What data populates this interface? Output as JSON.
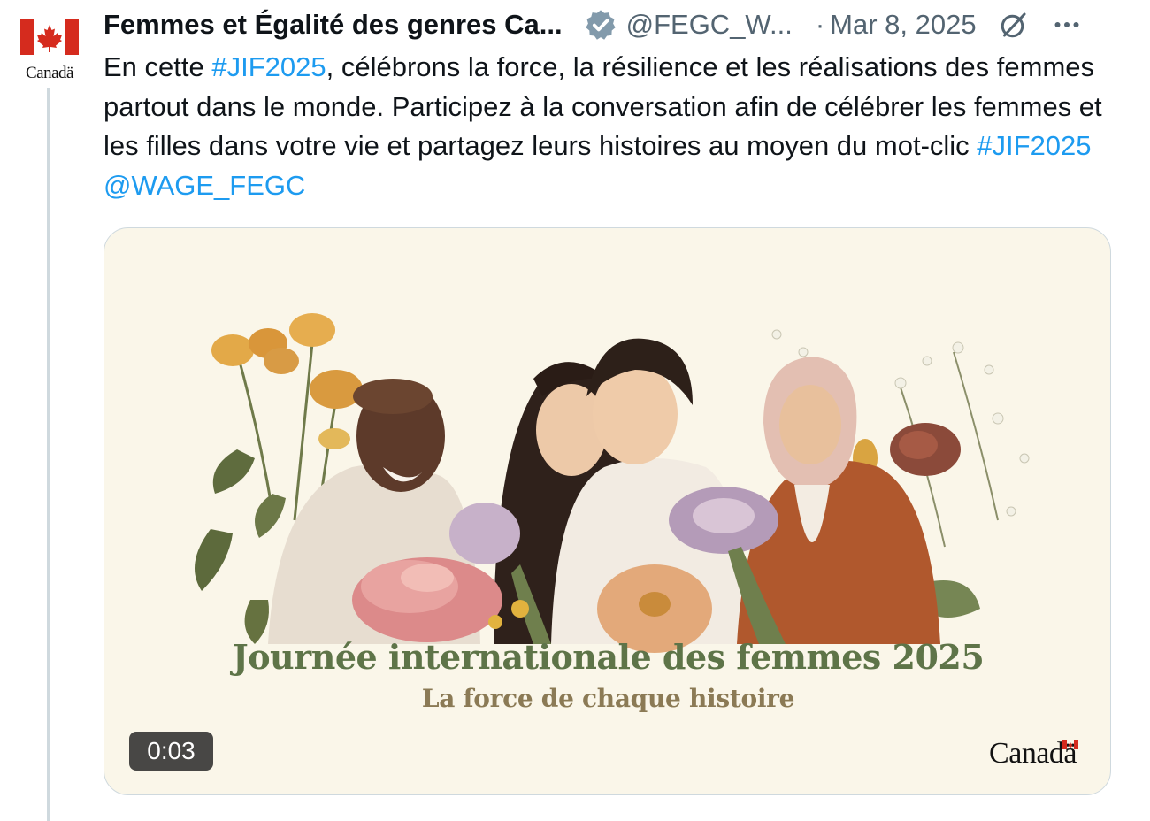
{
  "tweet": {
    "author_name": "Femmes et Égalité des genres Ca...",
    "handle": "@FEGC_W...",
    "separator": "·",
    "date": "Mar 8, 2025",
    "avatar_wordmark": "Canadä",
    "text_parts": {
      "t1": "En cette ",
      "hashtag1": "#JIF2025",
      "t2": ", célébrons la force, la résilience et les réalisations des femmes partout dans le monde. Participez à la conversation afin de célébrer les femmes et les filles dans votre vie et partagez leurs histoires au moyen du mot-clic ",
      "hashtag2": "#JIF2025",
      "space": " ",
      "mention": "@WAGE_FEGC"
    }
  },
  "media": {
    "title": "Journée internationale des femmes 2025",
    "subtitle": "La force de chaque histoire",
    "duration": "0:03",
    "wordmark": "Canadä"
  },
  "icons": {
    "verified": "verified-badge-icon",
    "grok": "grok-icon",
    "more": "more-icon"
  },
  "colors": {
    "link": "#1d9bf0",
    "secondary_text": "#536471",
    "title_green": "#5e7448",
    "subtitle_tan": "#8b7a55",
    "flag_red": "#d52b1e"
  }
}
